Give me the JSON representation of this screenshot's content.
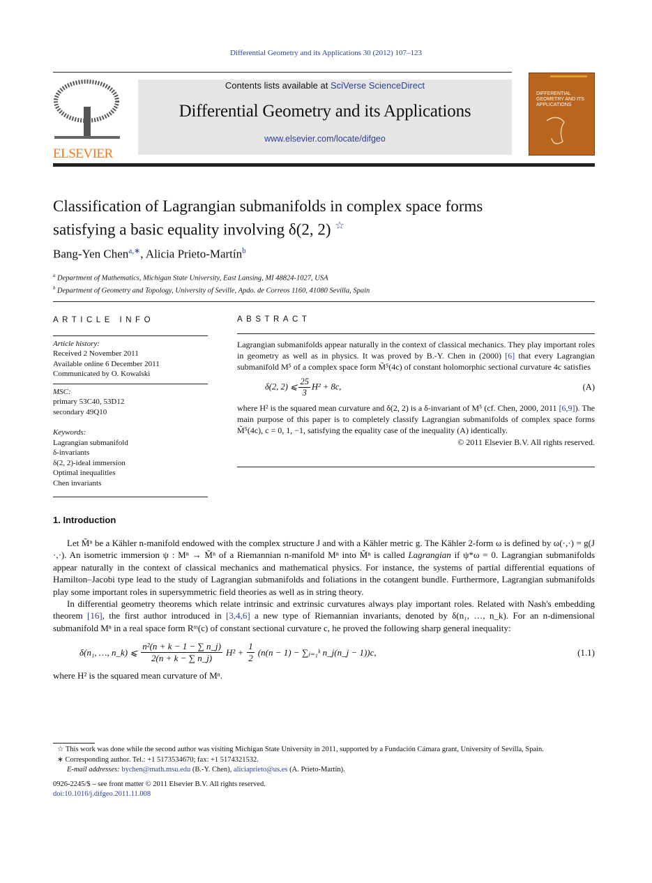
{
  "header": {
    "journal_ref": "Differential Geometry and its Applications 30 (2012) 107–123",
    "contents_prefix": "Contents lists available at ",
    "contents_link": "SciVerse ScienceDirect",
    "journal_title": "Differential Geometry and its Applications",
    "journal_url": "www.elsevier.com/locate/difgeo",
    "publisher_logo": "ELSEVIER",
    "cover_text": "DIFFERENTIAL GEOMETRY AND ITS APPLICATIONS"
  },
  "colors": {
    "link": "#2a3f9c",
    "elsevier": "#f07b1f",
    "cover": "#b8651f",
    "banner": "#e6e6e6"
  },
  "article": {
    "title_line1": "Classification of Lagrangian submanifolds in complex space forms",
    "title_line2": "satisfying a basic equality involving δ(2, 2)",
    "title_star": "☆",
    "authors": [
      {
        "name": "Bang-Yen Chen",
        "sup": "a,∗"
      },
      {
        "name": "Alicia Prieto-Martín",
        "sup": "b"
      }
    ],
    "affiliations": [
      {
        "sup": "a",
        "text": "Department of Mathematics, Michigan State University, East Lansing, MI 48824-1027, USA"
      },
      {
        "sup": "b",
        "text": "Department of Geometry and Topology, University of Seville, Apdo. de Correos 1160, 41080 Sevilla, Spain"
      }
    ]
  },
  "info": {
    "heading": "ARTICLE INFO",
    "history_label": "Article history:",
    "history": [
      "Received 2 November 2011",
      "Available online 6 December 2011",
      "Communicated by O. Kowalski"
    ],
    "msc_label": "MSC:",
    "msc": [
      "primary 53C40, 53D12",
      "secondary 49Q10"
    ],
    "keywords_label": "Keywords:",
    "keywords": [
      "Lagrangian submanifold",
      "δ-invariants",
      "δ(2, 2)-ideal immersion",
      "Optimal inequalities",
      "Chen invariants"
    ]
  },
  "abstract": {
    "heading": "ABSTRACT",
    "p1a": "Lagrangian submanifolds appear naturally in the context of classical mechanics. They play important roles in geometry as well as in physics. It was proved by B.-Y. Chen in (2000) ",
    "ref1": "[6]",
    "p1b": " that every Lagrangian submanifold M⁵ of a complex space form M̃⁵(4c) of constant holomorphic sectional curvature 4c satisfies",
    "eq_lhs": "δ(2, 2) ⩽",
    "eq_num": "25",
    "eq_den": "3",
    "eq_rhs": "H² + 8c,",
    "eq_label": "(A)",
    "p2a": "where H² is the squared mean curvature and δ(2, 2) is a δ-invariant of M⁵ (cf. Chen, 2000, 2011 ",
    "ref2": "[6,9]",
    "p2b": "). The main purpose of this paper is to completely classify Lagrangian submanifolds of complex space forms M̃⁵(4c), c = 0, 1, −1, satisfying the equality case of the inequality (A) identically.",
    "copyright": "© 2011 Elsevier B.V. All rights reserved."
  },
  "intro": {
    "heading": "1. Introduction",
    "p1a": "Let M̃ⁿ be a Kähler n-manifold endowed with the complex structure J and with a Kähler metric g. The Kähler 2-form ω is defined by ω(·,·) = g(J ·,·). An isometric immersion ψ : Mⁿ → M̃ⁿ of a Riemannian n-manifold Mⁿ into M̃ⁿ is called ",
    "p1em": "Lagrangian",
    "p1b": " if ψ*ω = 0. Lagrangian submanifolds appear naturally in the context of classical mechanics and mathematical physics. For instance, the systems of partial differential equations of Hamilton–Jacobi type lead to the study of Lagrangian submanifolds and foliations in the cotangent bundle. Furthermore, Lagrangian submanifolds play some important roles in supersymmetric field theories as well as in string theory.",
    "p2a": "In differential geometry theorems which relate intrinsic and extrinsic curvatures always play important roles. Related with Nash's embedding theorem ",
    "ref1": "[16]",
    "p2b": ", the first author introduced in ",
    "ref2": "[3,4,6]",
    "p2c": " a new type of Riemannian invariants, denoted by δ(n₁, …, n_k). For an n-dimensional submanifold Mⁿ in a real space form Rᵐ(c) of constant sectional curvature c, he proved the following sharp general inequality:",
    "eq_lhs": "δ(n₁, …, n_k) ⩽",
    "eq_num": "n²(n + k − 1 − ∑ n_j)",
    "eq_den": "2(n + k − ∑ n_j)",
    "eq_mid": "H² +",
    "eq_half_num": "1",
    "eq_half_den": "2",
    "eq_paren": "(n(n − 1) − ∑ⱼ₌₁ᵏ n_j(n_j − 1))c,",
    "eq_label": "(1.1)",
    "p3": "where H² is the squared mean curvature of Mⁿ."
  },
  "footnotes": {
    "star_mark": "☆",
    "star_text": "This work was done while the second author was visiting Michigan State University in 2011, supported by a Fundación Cámara grant, University of Sevilla, Spain.",
    "corr_mark": "∗",
    "corr_text": "Corresponding author. Tel.: +1 5173534670; fax: +1 5174321532.",
    "email_label": "E-mail addresses:",
    "email1": "bychen@math.msu.edu",
    "email1_who": " (B.-Y. Chen), ",
    "email2": "aliciaprieto@us.es",
    "email2_who": " (A. Prieto-Martín).",
    "issn": "0926-2245/$ – see front matter  © 2011 Elsevier B.V. All rights reserved.",
    "doi": "doi:10.1016/j.difgeo.2011.11.008"
  }
}
